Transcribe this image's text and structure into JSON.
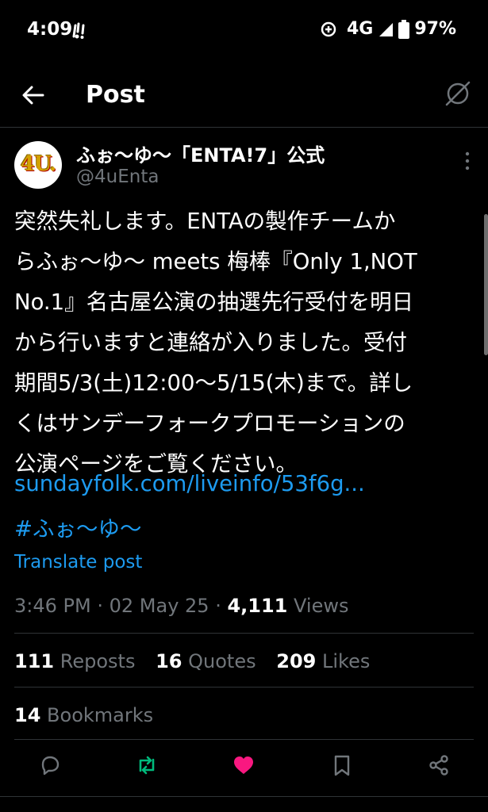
{
  "status_bar": {
    "time": "4:09",
    "network": "4G",
    "battery": "97%"
  },
  "header": {
    "title": "Post"
  },
  "post": {
    "avatar_text": "4U.",
    "display_name": "ふぉ〜ゆ〜「ENTA!7」公式",
    "handle": "@4uEnta",
    "text_lines": [
      "突然失礼します。ENTAの製作チームか",
      "らふぉ〜ゆ〜 meets 梅棒『Only 1,NOT",
      "No.1』名古屋公演の抽選先行受付を明日",
      "から行いますと連絡が入りました。受付",
      "期間5/3(土)12:00〜5/15(木)まで。詳し",
      "くはサンデーフォークプロモーションの",
      "公演ページをご覧ください。"
    ],
    "link": "sundayfolk.com/liveinfo/53f6g...",
    "hashtag": "#ふぉ〜ゆ〜",
    "translate_label": "Translate post",
    "time": "3:46 PM",
    "date": "02 May 25",
    "views_count": "4,111",
    "views_label": "Views"
  },
  "stats": {
    "reposts_count": "111",
    "reposts_label": "Reposts",
    "quotes_count": "16",
    "quotes_label": "Quotes",
    "likes_count": "209",
    "likes_label": "Likes",
    "bookmarks_count": "14",
    "bookmarks_label": "Bookmarks"
  },
  "colors": {
    "accent": "#1d9bf0",
    "like": "#f91880",
    "repost": "#00ba7c",
    "muted": "#71767b",
    "divider": "#2f3336"
  }
}
